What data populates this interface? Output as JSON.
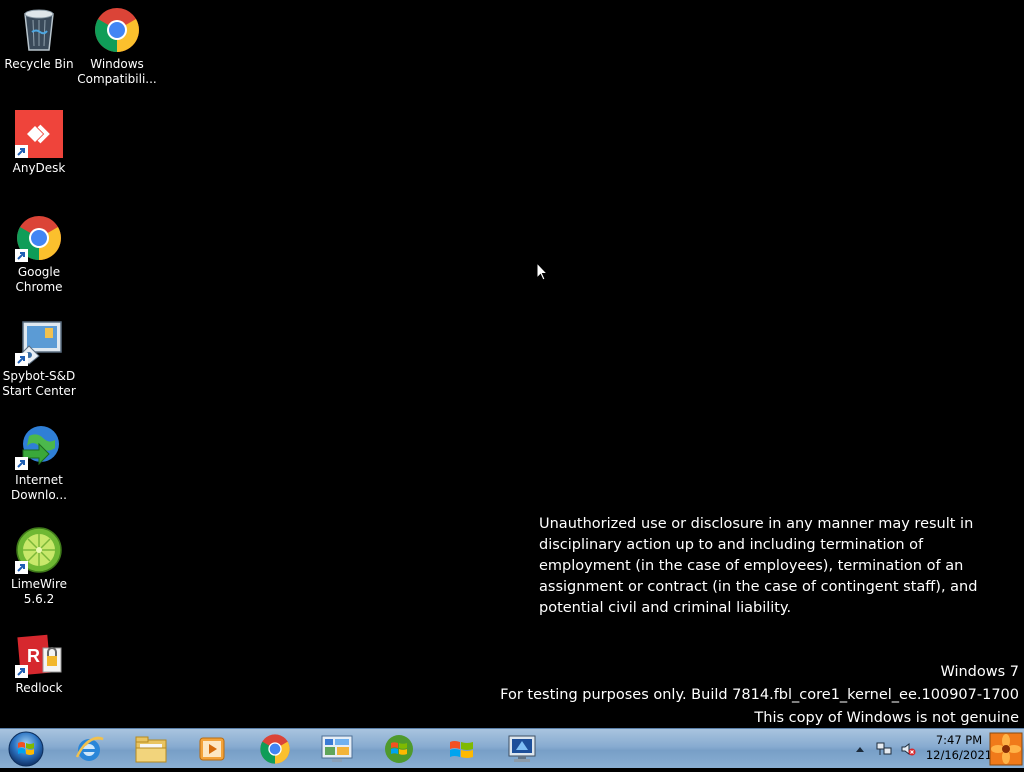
{
  "desktop_icons": [
    {
      "id": "recycle-bin",
      "label": "Recycle Bin",
      "icon": "recycle-bin-icon"
    },
    {
      "id": "windows-compat",
      "label": "Windows\nCompatibili...",
      "icon": "chrome-icon"
    },
    {
      "id": "anydesk",
      "label": "AnyDesk",
      "icon": "anydesk-icon"
    },
    {
      "id": "google-chrome",
      "label": "Google\nChrome",
      "icon": "chrome-icon"
    },
    {
      "id": "spybot",
      "label": "Spybot-S&D\nStart Center",
      "icon": "spybot-icon"
    },
    {
      "id": "internet-download",
      "label": "Internet\nDownlo...",
      "icon": "internet-download-manager-icon"
    },
    {
      "id": "limewire",
      "label": "LimeWire\n5.6.2",
      "icon": "limewire-icon"
    },
    {
      "id": "redlock",
      "label": "Redlock",
      "icon": "redlock-icon"
    }
  ],
  "notice": {
    "text": "Unauthorized use or disclosure in any manner may result in disciplinary action up to and including termination of employment (in the case of employees), termination of an assignment or contract (in the case of contingent staff), and potential civil and criminal liability."
  },
  "watermark": {
    "line1": "Windows 7",
    "line2": "For testing purposes only. Build 7814.fbl_core1_kernel_ee.100907-1700",
    "line3": "This copy of Windows is not genuine"
  },
  "taskbar": {
    "start_icon": "windows-orb-icon",
    "pinned": [
      {
        "id": "ie",
        "icon": "internet-explorer-icon"
      },
      {
        "id": "explorer",
        "icon": "folder-icon"
      },
      {
        "id": "media-player",
        "icon": "media-player-icon"
      },
      {
        "id": "chrome",
        "icon": "chrome-icon"
      },
      {
        "id": "control-panel",
        "icon": "control-panel-icon"
      },
      {
        "id": "windows-logo-green",
        "icon": "windows-logo-icon"
      },
      {
        "id": "windows-logo",
        "icon": "windows-logo-icon"
      },
      {
        "id": "remote-desktop",
        "icon": "remote-desktop-icon"
      }
    ]
  },
  "tray": {
    "time": "7:47 PM",
    "date": "12/16/2021"
  },
  "colors": {
    "desktop_bg": "#000000",
    "taskbar_top": "#a9c4df",
    "taskbar_bottom": "#789fc7"
  }
}
